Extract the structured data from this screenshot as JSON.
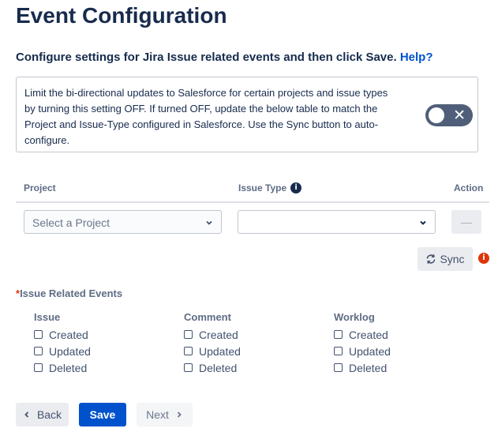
{
  "header": {
    "title": "Event Configuration"
  },
  "intro": {
    "text": "Configure settings for Jira Issue related events and then click Save.",
    "help_link": "Help?"
  },
  "info_box": {
    "text": "Limit the bi-directional updates to Salesforce for certain projects and issue types by turning this setting OFF. If turned OFF, update the below table to match the Project and Issue-Type configured in Salesforce. Use the Sync button to auto-configure.",
    "toggle_state": "off"
  },
  "table": {
    "headers": {
      "project": "Project",
      "issue_type": "Issue Type",
      "action": "Action"
    },
    "project_select": {
      "placeholder": "Select a Project"
    },
    "issue_type_select": {
      "value": ""
    },
    "remove_button": {
      "label": "—"
    }
  },
  "sync": {
    "label": "Sync"
  },
  "events": {
    "required_mark": "*",
    "label": "Issue Related Events",
    "groups": [
      {
        "title": "Issue",
        "options": [
          {
            "label": "Created",
            "checked": false
          },
          {
            "label": "Updated",
            "checked": false
          },
          {
            "label": "Deleted",
            "checked": false
          }
        ]
      },
      {
        "title": "Comment",
        "options": [
          {
            "label": "Created",
            "checked": false
          },
          {
            "label": "Updated",
            "checked": false
          },
          {
            "label": "Deleted",
            "checked": false
          }
        ]
      },
      {
        "title": "Worklog",
        "options": [
          {
            "label": "Created",
            "checked": false
          },
          {
            "label": "Updated",
            "checked": false
          },
          {
            "label": "Deleted",
            "checked": false
          }
        ]
      }
    ]
  },
  "footer": {
    "back_label": "Back",
    "save_label": "Save",
    "next_label": "Next"
  },
  "colors": {
    "primary": "#0052cc",
    "text": "#172b4d",
    "muted": "#5e6c84",
    "error": "#de350b",
    "toggle_off": "#505f79"
  }
}
